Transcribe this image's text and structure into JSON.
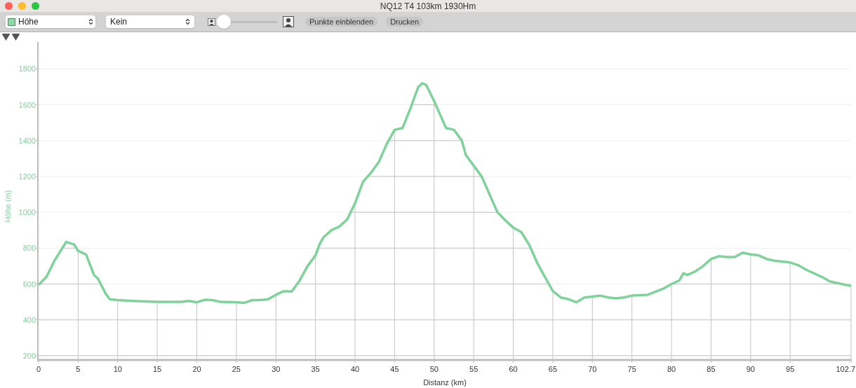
{
  "window": {
    "title": "NQ12 T4 103km 1930Hm"
  },
  "toolbar": {
    "overlay_select": {
      "value": "Kein"
    },
    "zoom_slider": {
      "level": 0
    },
    "buttons": [
      "Punkte einblenden",
      "Drucken"
    ]
  },
  "chart": {
    "chart_data": {
      "type": "line",
      "grid": true,
      "ref_lines": [
        {
          "axis": "x",
          "value": 5,
          "color": "#c4c4c4"
        },
        {
          "axis": "x",
          "value": 10,
          "color": "#c4c4c4"
        },
        {
          "axis": "x",
          "value": 15,
          "color": "#c4c4c4"
        },
        {
          "axis": "x",
          "value": 20,
          "color": "#c4c4c4"
        },
        {
          "axis": "x",
          "value": 25,
          "color": "#c4c4c4"
        },
        {
          "axis": "x",
          "value": 30,
          "color": "#c4c4c4"
        },
        {
          "axis": "x",
          "value": 35,
          "color": "#c4c4c4"
        },
        {
          "axis": "x",
          "value": 40,
          "color": "#c4c4c4"
        },
        {
          "axis": "x",
          "value": 45,
          "color": "#c4c4c4"
        },
        {
          "axis": "x",
          "value": 50,
          "color": "#c4c4c4"
        },
        {
          "axis": "x",
          "value": 55,
          "color": "#c4c4c4"
        },
        {
          "axis": "x",
          "value": 60,
          "color": "#c4c4c4"
        },
        {
          "axis": "x",
          "value": 65,
          "color": "#c4c4c4"
        },
        {
          "axis": "x",
          "value": 70,
          "color": "#c4c4c4"
        },
        {
          "axis": "x",
          "value": 75,
          "color": "#c4c4c4"
        },
        {
          "axis": "x",
          "value": 80,
          "color": "#c4c4c4"
        },
        {
          "axis": "x",
          "value": 85,
          "color": "#c4c4c4"
        },
        {
          "axis": "x",
          "value": 90,
          "color": "#c4c4c4"
        },
        {
          "axis": "x",
          "value": 95,
          "color": "#c4c4c4"
        },
        {
          "axis": "x",
          "value": 102.7,
          "color": "#c4c4c4"
        }
      ],
      "xlabel": "Distanz (km)",
      "ylabel": "Höhe (m)",
      "xlim": [
        0,
        102.7
      ],
      "ylim": [
        180,
        1950
      ],
      "xticks": [
        0,
        5,
        10,
        15,
        20,
        25,
        30,
        35,
        40,
        45,
        50,
        55,
        60,
        65,
        70,
        75,
        80,
        85,
        90,
        95,
        102.7
      ],
      "yticks": [
        200,
        400,
        600,
        800,
        1000,
        1200,
        1400,
        1600,
        1800
      ],
      "x": [
        0,
        1,
        2,
        3,
        3.5,
        4.5,
        5,
        6,
        7,
        7.5,
        8.5,
        9,
        10,
        12,
        15,
        18,
        19,
        20,
        21,
        22,
        23,
        25,
        26,
        27,
        28,
        29,
        30,
        31,
        32,
        33,
        34,
        35,
        35.5,
        36,
        37,
        38,
        39,
        40,
        41,
        42,
        43,
        44,
        45,
        46,
        47,
        48,
        48.5,
        49,
        50,
        51,
        51.5,
        52.5,
        53.5,
        54,
        55,
        56,
        57,
        58,
        59,
        60,
        61,
        62,
        63,
        64,
        65,
        66,
        67,
        68,
        69,
        70,
        71,
        72,
        73,
        74,
        75,
        77,
        79,
        80,
        81,
        81.5,
        82,
        83,
        84,
        85,
        86,
        87,
        88,
        89,
        90,
        91,
        92,
        93,
        95,
        96,
        97,
        99,
        100,
        101,
        102,
        102.7
      ],
      "series": [
        {
          "name": "Höhe",
          "color": "#7fd39a",
          "values": [
            595,
            640,
            730,
            800,
            835,
            820,
            785,
            765,
            650,
            630,
            545,
            515,
            510,
            505,
            500,
            500,
            505,
            498,
            512,
            510,
            500,
            498,
            495,
            510,
            510,
            515,
            540,
            560,
            558,
            620,
            700,
            760,
            820,
            860,
            900,
            920,
            960,
            1050,
            1170,
            1220,
            1280,
            1380,
            1460,
            1470,
            1580,
            1700,
            1720,
            1710,
            1620,
            1520,
            1470,
            1460,
            1400,
            1320,
            1260,
            1200,
            1100,
            1000,
            955,
            915,
            890,
            820,
            720,
            640,
            560,
            525,
            515,
            498,
            525,
            530,
            535,
            525,
            520,
            525,
            535,
            540,
            575,
            600,
            620,
            660,
            650,
            670,
            700,
            740,
            755,
            750,
            750,
            775,
            765,
            760,
            740,
            730,
            720,
            705,
            680,
            640,
            615,
            605,
            595,
            590
          ]
        }
      ]
    }
  }
}
